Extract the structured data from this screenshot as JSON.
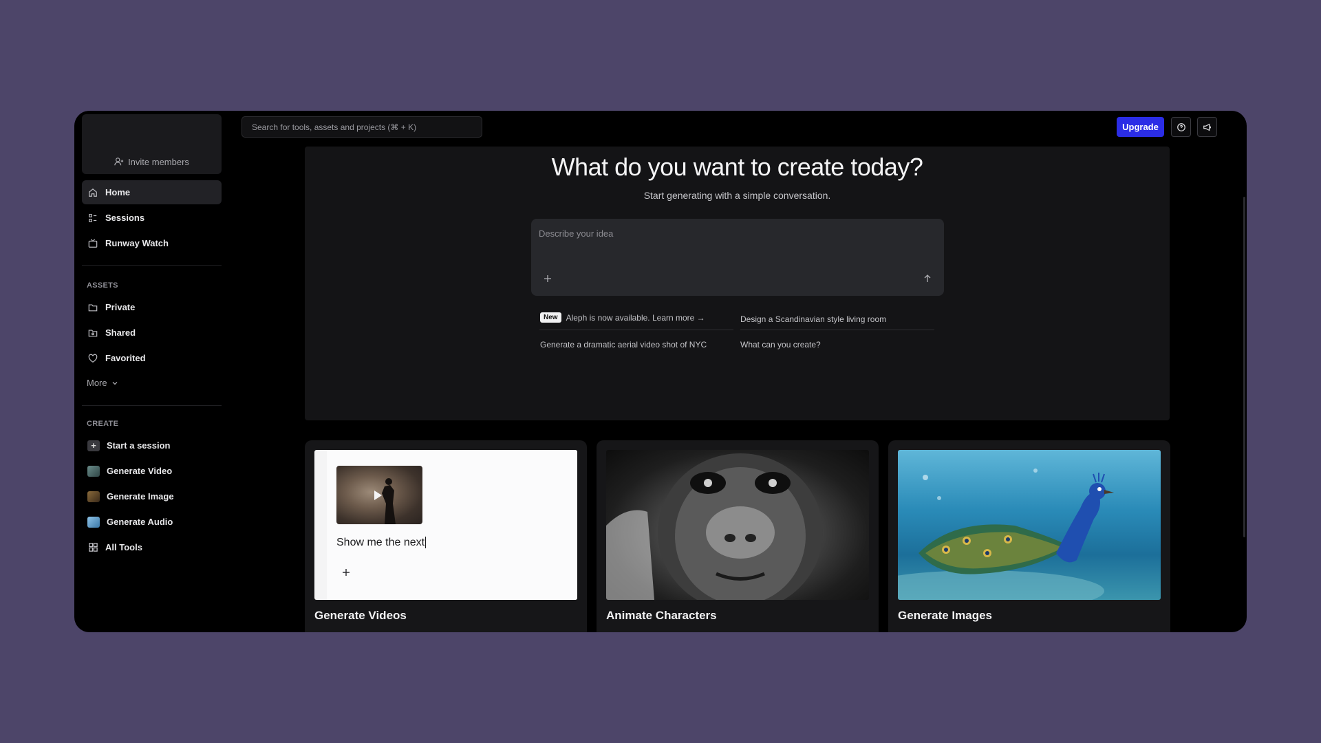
{
  "sidebar": {
    "invite_label": "Invite members",
    "nav": [
      {
        "label": "Home",
        "icon": "home-icon"
      },
      {
        "label": "Sessions",
        "icon": "grid-list-icon"
      },
      {
        "label": "Runway Watch",
        "icon": "tv-icon"
      }
    ],
    "assets_header": "ASSETS",
    "assets": [
      {
        "label": "Private",
        "icon": "folder-icon"
      },
      {
        "label": "Shared",
        "icon": "shared-folder-icon"
      },
      {
        "label": "Favorited",
        "icon": "heart-icon"
      }
    ],
    "more_label": "More",
    "create_header": "CREATE",
    "create": [
      {
        "label": "Start a session",
        "icon": "plus-icon"
      },
      {
        "label": "Generate Video",
        "icon": "video-thumb-icon"
      },
      {
        "label": "Generate Image",
        "icon": "image-thumb-icon"
      },
      {
        "label": "Generate Audio",
        "icon": "audio-thumb-icon"
      },
      {
        "label": "All Tools",
        "icon": "apps-grid-icon"
      }
    ]
  },
  "topbar": {
    "search_placeholder": "Search for tools, assets and projects (⌘ + K)",
    "upgrade_label": "Upgrade",
    "help_icon": "help-chat-icon",
    "announce_icon": "megaphone-icon"
  },
  "hero": {
    "title": "What do you want to create today?",
    "subtitle": "Start generating with a simple conversation.",
    "prompt_placeholder": "Describe your idea",
    "suggestions": {
      "new_badge": "New",
      "aleph": "Aleph is now available. Learn more →",
      "scandinavian": "Design a Scandinavian style living room",
      "nyc": "Generate a dramatic aerial video shot of NYC",
      "what": "What can you create?"
    }
  },
  "cards": [
    {
      "title": "Generate Videos",
      "mock_text": "Show me the next"
    },
    {
      "title": "Animate Characters"
    },
    {
      "title": "Generate Images"
    }
  ],
  "colors": {
    "background": "#4d4569",
    "app": "#000000",
    "accent": "#2b2de6"
  }
}
